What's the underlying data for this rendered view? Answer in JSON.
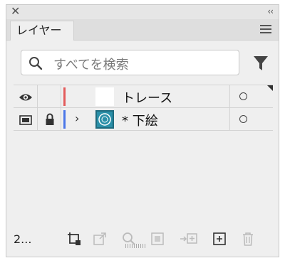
{
  "panel": {
    "tab_label": "レイヤー"
  },
  "search": {
    "placeholder": "すべてを検索"
  },
  "layers": [
    {
      "name": "トレース",
      "color": "#e35b5b",
      "visible": true,
      "locked": false,
      "has_children": false
    },
    {
      "name": "* 下絵",
      "color": "#4a76e8",
      "visible": true,
      "locked": true,
      "has_children": true
    }
  ],
  "footer": {
    "count_label": "2..."
  },
  "icons": {
    "close": "close-icon",
    "collapse": "collapse-icon",
    "menu": "hamburger-menu-icon",
    "search": "search-icon",
    "filter": "filter-icon",
    "eye": "eye-icon",
    "lock": "lock-icon",
    "expand": "chevron-right-icon",
    "target": "target-circle-icon",
    "artboard": "artboard-icon",
    "export": "export-icon",
    "locate": "locate-object-icon",
    "mask": "clipping-mask-icon",
    "sublayer": "new-sublayer-icon",
    "newlayer": "new-layer-icon",
    "delete": "trash-icon"
  }
}
